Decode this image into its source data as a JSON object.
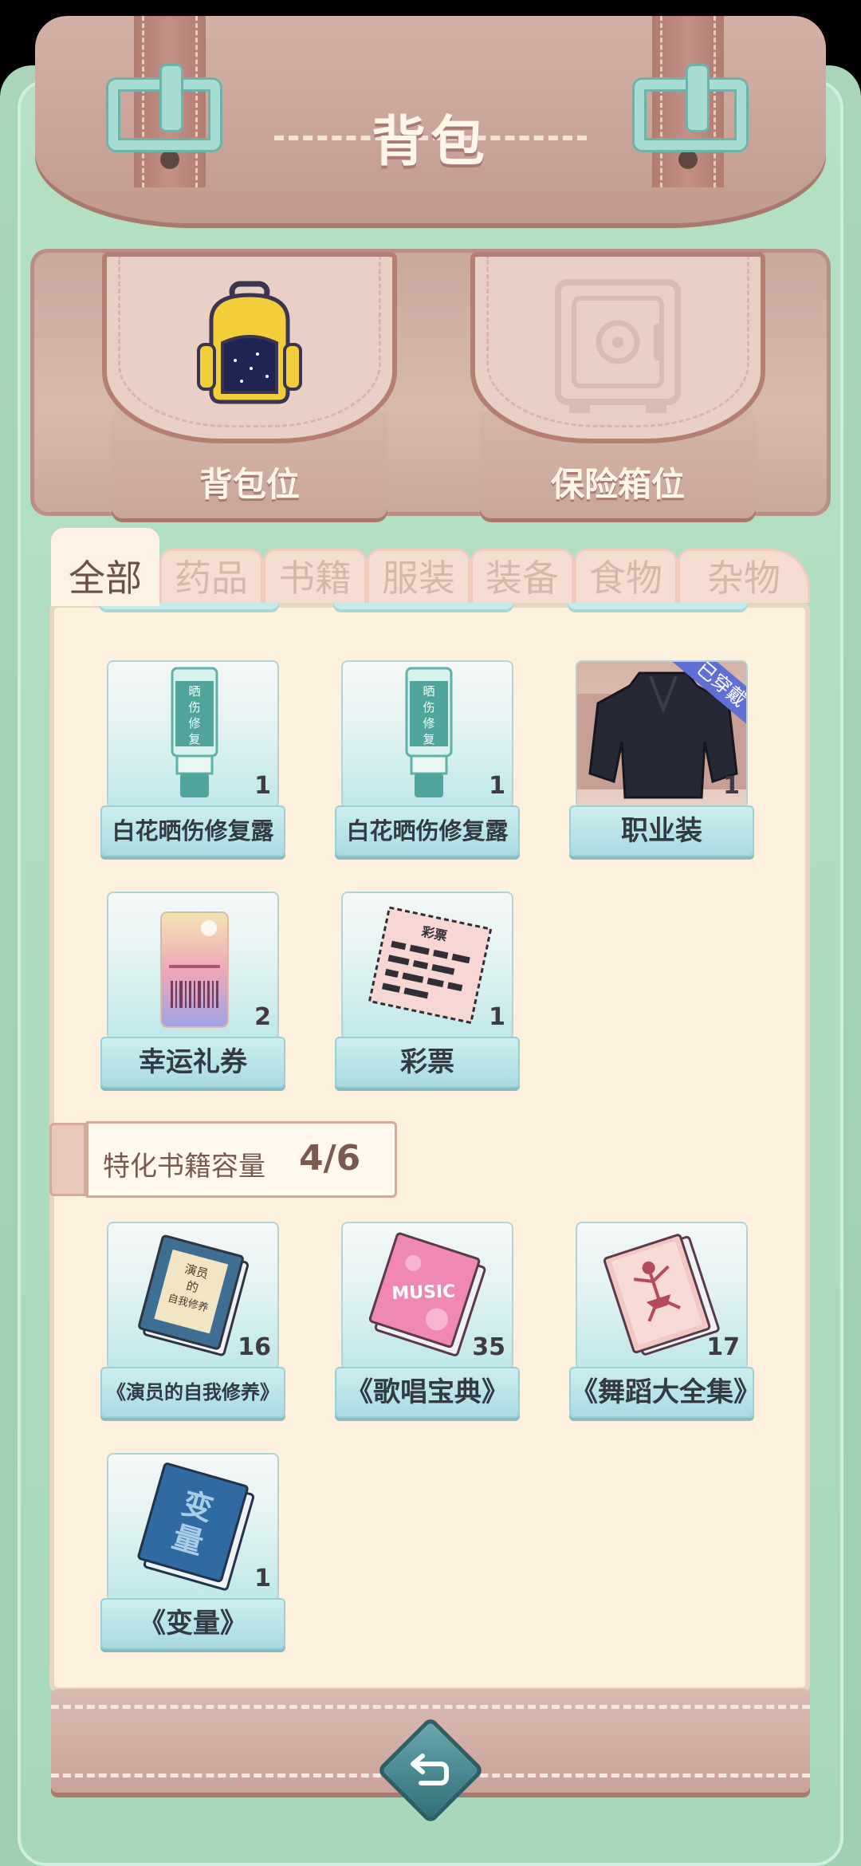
{
  "header": {
    "title": "背包"
  },
  "pockets": [
    {
      "label": "背包位",
      "icon": "backpack-icon"
    },
    {
      "label": "保险箱位",
      "icon": "safe-icon"
    }
  ],
  "tabs": [
    {
      "label": "全部",
      "active": true
    },
    {
      "label": "药品",
      "active": false
    },
    {
      "label": "书籍",
      "active": false
    },
    {
      "label": "服装",
      "active": false
    },
    {
      "label": "装备",
      "active": false
    },
    {
      "label": "食物",
      "active": false
    },
    {
      "label": "杂物",
      "active": false
    }
  ],
  "items": [
    {
      "name": "白花晒伤修复露",
      "count": "1",
      "icon": "lotion-tube-icon"
    },
    {
      "name": "白花晒伤修复露",
      "count": "1",
      "icon": "lotion-tube-icon"
    },
    {
      "name": "职业装",
      "count": "1",
      "icon": "suit-jacket-icon",
      "badge": "已穿戴"
    },
    {
      "name": "幸运礼券",
      "count": "2",
      "icon": "coupon-icon"
    },
    {
      "name": "彩票",
      "count": "1",
      "icon": "lottery-ticket-icon",
      "ticket_header": "彩票"
    }
  ],
  "books_section": {
    "capacity_label": "特化书籍容量",
    "capacity_value": "4/6",
    "items": [
      {
        "name": "《演员的自我修养》",
        "count": "16",
        "icon": "book-icon",
        "cover_text": "演员的自我修养"
      },
      {
        "name": "《歌唱宝典》",
        "count": "35",
        "icon": "music-book-icon",
        "cover_text": "MUSIC"
      },
      {
        "name": "《舞蹈大全集》",
        "count": "17",
        "icon": "dance-book-icon"
      },
      {
        "name": "《变量》",
        "count": "1",
        "icon": "book-icon",
        "cover_text": "变量"
      }
    ]
  },
  "footer": {
    "back_icon": "return-icon"
  },
  "colors": {
    "accent": "#5f6fd6",
    "frame": "#a9d6b8",
    "leather": "#c29a8f",
    "panel": "#fdf0dc"
  }
}
